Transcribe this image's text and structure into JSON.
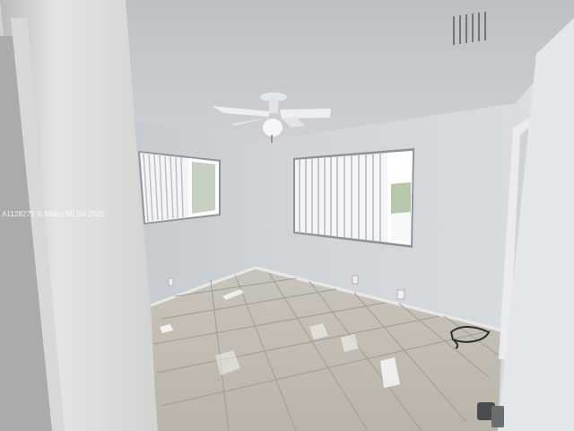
{
  "photo": {
    "subject": "empty bedroom",
    "watermark": "A1128279 © Miami MLS® 2025",
    "colors": {
      "ceiling": "#c4c9cd",
      "wall_left": "#c9ced3",
      "wall_back": "#d2d6d9",
      "wall_right": "#d9dde0",
      "floor": "#c2bcb2",
      "grout": "#9e978d",
      "door_frame": "#e2e3e0",
      "window_light": "#ffffff",
      "blinds": "#dcdfe1"
    }
  }
}
